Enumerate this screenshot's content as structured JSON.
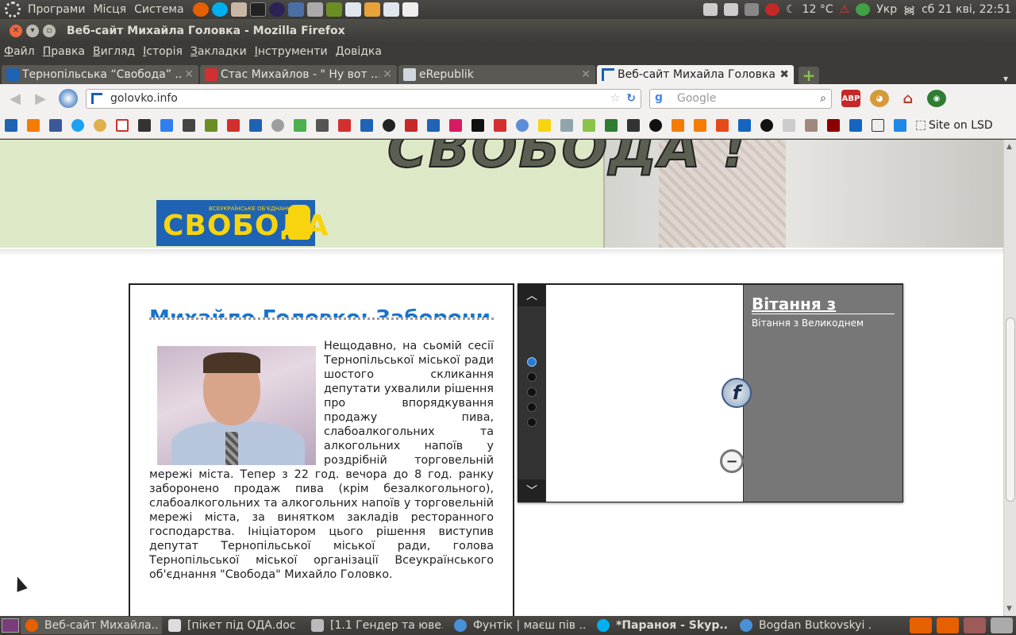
{
  "top_panel": {
    "menus": [
      "Програми",
      "Місця",
      "Система"
    ],
    "temperature": "12 °C",
    "keyboard_layout": "Укр",
    "clock": "сб 21 кві, 22:51"
  },
  "window": {
    "title": "Веб-сайт Михайла Головка - Mozilla Firefox"
  },
  "menubar": [
    "Файл",
    "Правка",
    "Вигляд",
    "Історія",
    "Закладки",
    "Інструменти",
    "Довідка"
  ],
  "tabs": [
    {
      "label": "Тернопільська “Свобода” ...",
      "active": false
    },
    {
      "label": "Стас Михайлов - \" Ну вот ...",
      "active": false
    },
    {
      "label": "eRepublik",
      "active": false
    },
    {
      "label": "Веб-сайт Михайла Головка",
      "active": true
    }
  ],
  "navbar": {
    "url": "golovko.info",
    "search_placeholder": "Google"
  },
  "bookmarks": {
    "last_label": "Site on LSD"
  },
  "page": {
    "banner_slogan": "СВОБОДА !",
    "logo_small": "ВСЕУКРАЇНСЬКЕ ОБ'ЄДНАННЯ",
    "logo_big": "СВОБОДА",
    "article_headline": "Михайло Головко: Заборони",
    "article_body": "Нещодавно, на сьомій сесії Тернопільської міської ради шостого скликання депутати ухвалили рішення про впорядкування продажу пива, слабоалкогольних та алкогольних напоїв у роздрібній торговельній мережі міста. Тепер з 22 год. вечора до 8 год. ранку заборонено продаж пива (крім безалкогольного), слабоалкогольних та алкогольних напоїв у торговельній мережі міста, за винятком закладів ресторанного господарства. Ініціатором цього рішення виступив депутат Тернопільської міської ради, голова Тернопільської міської організації Всеукраїнського об'єднання \"Свобода\" Михайло Головко.",
    "slider": {
      "caption_title": "Вітання з",
      "caption_sub": "Вітання з Великоднем",
      "active_dot": 0,
      "dot_count": 5
    }
  },
  "taskbar": [
    {
      "label": "Веб-сайт Михайла...",
      "active": true,
      "bold": false
    },
    {
      "label": "[пікет під ОДА.doc ...",
      "active": false,
      "bold": false
    },
    {
      "label": "[1.1 Гендер та юве...",
      "active": false,
      "bold": false
    },
    {
      "label": "Фунтік | маєш пів ...",
      "active": false,
      "bold": false
    },
    {
      "label": "*Параноя - Skyp...",
      "active": false,
      "bold": true
    },
    {
      "label": "Bogdan Butkovskyi ...",
      "active": false,
      "bold": false
    }
  ],
  "colors": {
    "panel": "#3c3b37",
    "link_blue": "#1a73c9",
    "svoboda_blue": "#1e63b4",
    "svoboda_yellow": "#f8d40f",
    "banner_green": "#dde8c6"
  }
}
